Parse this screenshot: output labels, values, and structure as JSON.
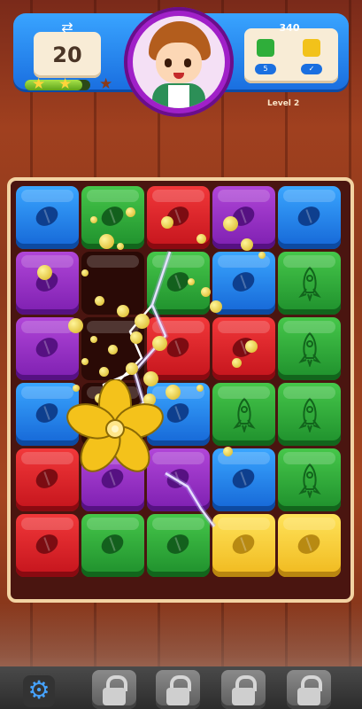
{
  "header": {
    "moves": "20",
    "swap_icon": "⇄",
    "score": "340",
    "level_label": "Level 2",
    "stars": {
      "earned": 2,
      "total": 3,
      "progress": 0.88
    },
    "goals": [
      {
        "color": "#2fae3a",
        "icon": "green-square",
        "badge": "5"
      },
      {
        "color": "#f2c21a",
        "icon": "yellow-square",
        "badge": "✓"
      }
    ]
  },
  "board": {
    "columns": 5,
    "rows": 6,
    "tiles": [
      [
        "blue-bean",
        "green-bean",
        "red-bean",
        "purple-bean",
        "blue-bean"
      ],
      [
        "purple-bean",
        "empty",
        "green-bean",
        "blue-bean",
        "green-rocket"
      ],
      [
        "purple-bean",
        "empty",
        "red-bean",
        "red-bean",
        "green-rocket"
      ],
      [
        "blue-bean",
        "empty",
        "blue-bean",
        "green-rocket",
        "green-rocket"
      ],
      [
        "red-bean",
        "purple-bean",
        "purple-bean",
        "blue-bean",
        "green-rocket"
      ],
      [
        "red-bean",
        "green-bean",
        "green-bean",
        "yellow-bean",
        "yellow-bean"
      ]
    ],
    "booster": "pinwheel-icon",
    "effect": "lightning-icon"
  },
  "bottom_bar": {
    "settings_icon": "⚙",
    "boosters": [
      {
        "name": "locked-booster-1",
        "locked": true
      },
      {
        "name": "locked-booster-2",
        "locked": true
      },
      {
        "name": "locked-booster-3",
        "locked": true
      },
      {
        "name": "locked-booster-4",
        "locked": true
      }
    ]
  }
}
